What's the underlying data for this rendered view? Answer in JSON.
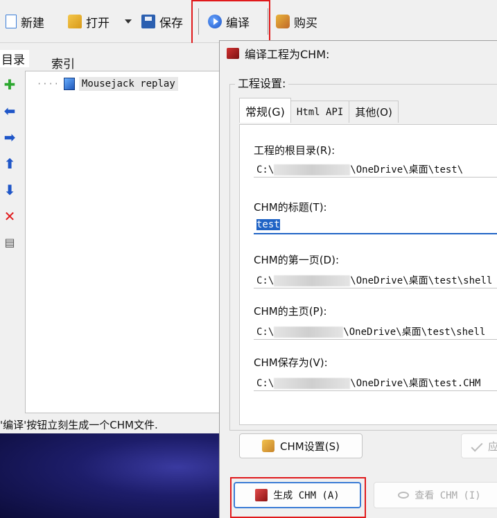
{
  "toolbar": {
    "new_label": "新建",
    "open_label": "打开",
    "save_label": "保存",
    "compile_label": "编译",
    "buy_label": "购买"
  },
  "left": {
    "tabs": [
      "目录",
      "索引"
    ],
    "tree_item": "Mousejack replay",
    "status": "'编译'按钮立刻生成一个CHM文件."
  },
  "dialog": {
    "title": "编译工程为CHM:",
    "group_label": "工程设置:",
    "tabs": [
      "常规(G)",
      "Html API",
      "其他(O)"
    ],
    "fields": {
      "root_label": "工程的根目录(R):",
      "root_value_prefix": "C:\\",
      "root_value_suffix": "\\OneDrive\\桌面\\test\\",
      "title_label": "CHM的标题(T):",
      "title_value": "test",
      "first_label": "CHM的第一页(D):",
      "first_value_prefix": "C:\\",
      "first_value_suffix": "\\OneDrive\\桌面\\test\\shell",
      "home_label": "CHM的主页(P):",
      "home_value_prefix": "C:\\",
      "home_value_suffix": "\\OneDrive\\桌面\\test\\shell",
      "saveas_label": "CHM保存为(V):",
      "saveas_value_prefix": "C:\\",
      "saveas_value_suffix": "\\OneDrive\\桌面\\test.CHM"
    },
    "chm_settings_button": "CHM设置(S)",
    "apply_button": "应",
    "generate_button": "生成 CHM (A)",
    "view_button": "查看 CHM (I)"
  }
}
